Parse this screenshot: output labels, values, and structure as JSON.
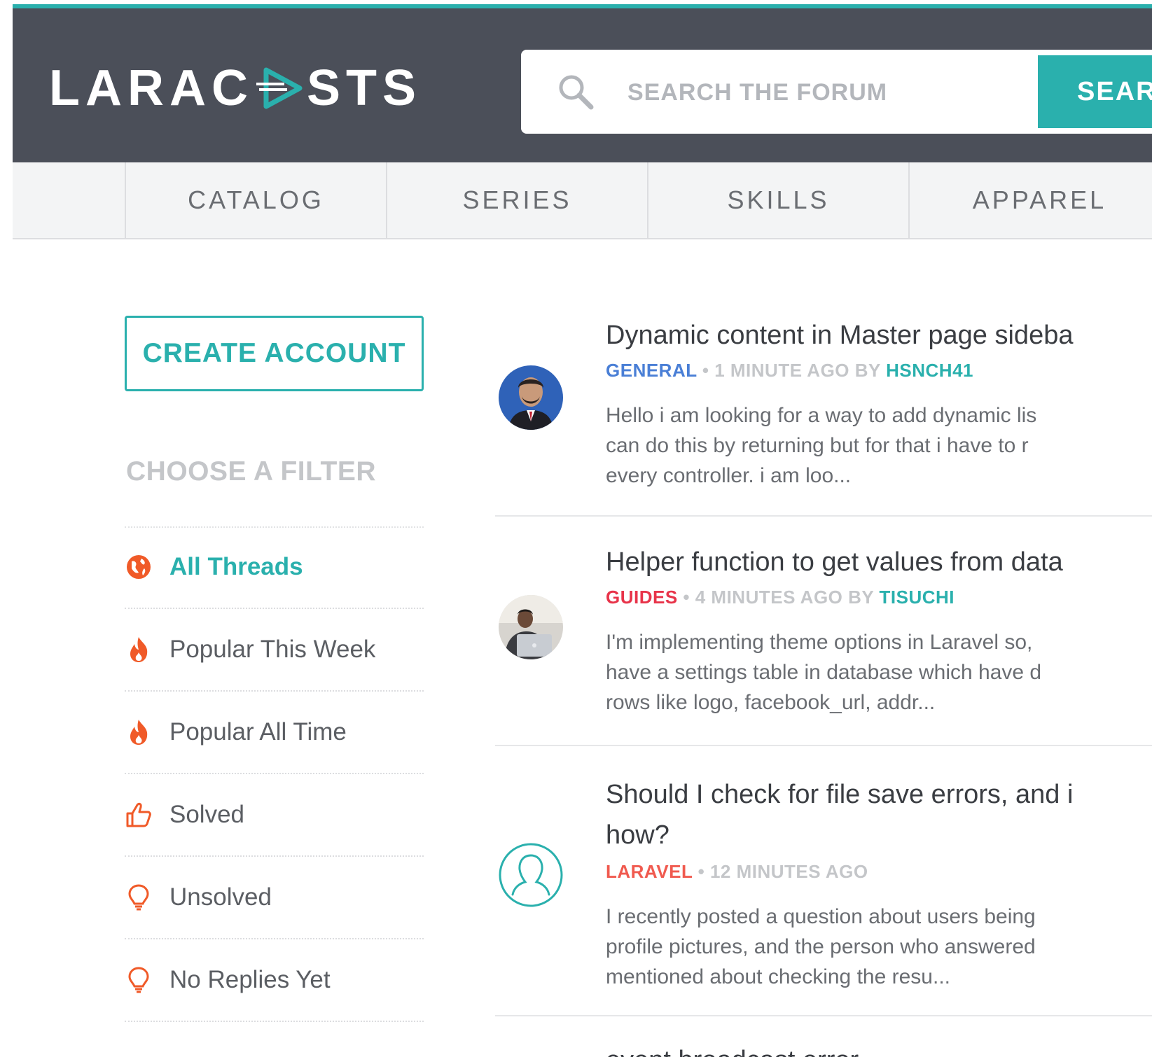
{
  "header": {
    "logo_left": "LARAC",
    "logo_right": "STS",
    "search": {
      "placeholder": "SEARCH THE FORUM",
      "button_label": "SEARCH"
    },
    "colors": {
      "background": "#4b4f59",
      "accent": "#2ab0ad"
    }
  },
  "nav": {
    "items": [
      "CATALOG",
      "SERIES",
      "SKILLS",
      "APPAREL"
    ]
  },
  "sidebar": {
    "create_account": "CREATE ACCOUNT",
    "filter_heading": "CHOOSE A FILTER",
    "filters": [
      {
        "label": "All Threads",
        "icon": "globe-icon",
        "active": true
      },
      {
        "label": "Popular This Week",
        "icon": "flame-icon",
        "active": false
      },
      {
        "label": "Popular All Time",
        "icon": "flame-icon",
        "active": false
      },
      {
        "label": "Solved",
        "icon": "thumbs-up-icon",
        "active": false
      },
      {
        "label": "Unsolved",
        "icon": "lightbulb-icon",
        "active": false
      },
      {
        "label": "No Replies Yet",
        "icon": "lightbulb-icon",
        "active": false
      }
    ]
  },
  "threads": [
    {
      "title": "Dynamic content in Master page sideba",
      "category": "GENERAL",
      "category_color": "#4a7fd6",
      "time": " • 1 MINUTE AGO BY ",
      "author": "HSNCH41",
      "excerpt": "Hello i am looking for a way to add dynamic lis\ncan do this by returning but for that i have to r\nevery controller. i am loo...",
      "avatar": "user-photo"
    },
    {
      "title": "Helper function to get values from data",
      "category": "GUIDES",
      "category_color": "#e8344a",
      "time": " • 4 MINUTES AGO BY ",
      "author": "TISUCHI",
      "excerpt": "I'm implementing theme options in Laravel so,\nhave a settings table in database which have d\nrows like logo, facebook_url, addr...",
      "avatar": "user-photo"
    },
    {
      "title_line1": "Should I check for file save errors, and i",
      "title_line2": "how?",
      "category": "LARAVEL",
      "category_color": "#f05a4f",
      "time": " • 12 MINUTES AGO",
      "author": "",
      "excerpt": "I recently posted a question about users being\nprofile pictures, and the person who answered\nmentioned about checking the resu...",
      "avatar": "default-user-icon"
    },
    {
      "title": "event broadcast error"
    }
  ]
}
